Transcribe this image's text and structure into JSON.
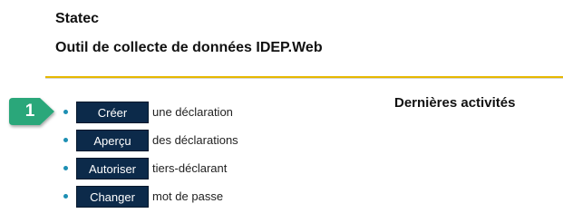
{
  "header": {
    "brand": "Statec",
    "app_title": "Outil de collecte de données IDEP.Web"
  },
  "colors": {
    "accent_line": "#e6b800",
    "button_bg": "#0c2a4a",
    "bullet": "#1d8fb3",
    "step_badge": "#2aa77a"
  },
  "step_badge": {
    "number": "1"
  },
  "actions": [
    {
      "button_label": "Créer",
      "text": "une déclaration"
    },
    {
      "button_label": "Aperçu",
      "text": "des déclarations"
    },
    {
      "button_label": "Autoriser",
      "text": "tiers-déclarant"
    },
    {
      "button_label": "Changer",
      "text": "mot de passe"
    }
  ],
  "activities": {
    "title": "Dernières activités"
  }
}
